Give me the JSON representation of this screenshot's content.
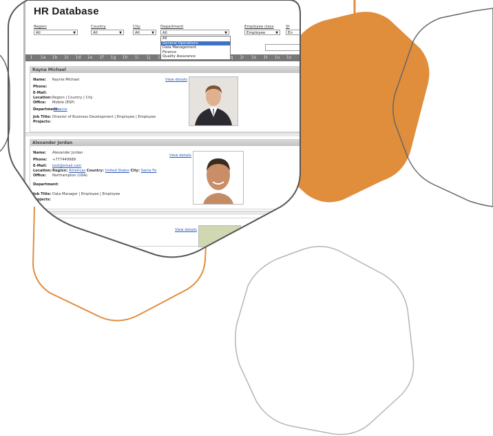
{
  "app": {
    "title": "HR Database"
  },
  "filters": [
    {
      "label": "Region",
      "value": "All"
    },
    {
      "label": "Country",
      "value": "All"
    },
    {
      "label": "City",
      "value": "All"
    },
    {
      "label": "Department",
      "value": "All"
    },
    {
      "label": "Employee class",
      "value": "Employee"
    },
    {
      "label": "St",
      "value": "En"
    }
  ],
  "department_dropdown": {
    "options": [
      "All",
      "General Operations",
      "Data Management",
      "Finance",
      "Quality Assurance"
    ],
    "highlighted": "General Operations"
  },
  "ruler": {
    "marks": [
      "1",
      "1a",
      "1b",
      "1c",
      "1d",
      "1e",
      "1f",
      "1g",
      "1h",
      "1i",
      "1j",
      "1k",
      "1l",
      "1m",
      "1n",
      "1o",
      "1p",
      "1q",
      "1r",
      "1s",
      "1t",
      "1u",
      "1v"
    ]
  },
  "employees": [
    {
      "name": "Rayna Michael",
      "name_value": "Raynie Michael",
      "phone": "",
      "email": "",
      "location": "Region | Country | City",
      "office": "Mobile (ESP)",
      "department": "Finance",
      "job_title": "Director of Business Development | Employee | Employee",
      "projects": "",
      "view_details": "View details"
    },
    {
      "name": "Alexander Jordan",
      "name_value": "Alexander Jordan",
      "phone": "+777449989",
      "email": "test@email.com",
      "location_region": "Americas",
      "location_country": "United States",
      "location_city": "Santa Fe",
      "office": "Northampton (USA)",
      "department": "",
      "job_title": "Data Manager | Employee | Employee",
      "projects": "",
      "view_details": "View details"
    }
  ],
  "field_labels": {
    "name": "Name:",
    "phone": "Phone:",
    "email": "E-Mail:",
    "location": "Location:",
    "office": "Office:",
    "department": "Department:",
    "job_title": "Job Title:",
    "projects": "Projects:",
    "region": "Region:",
    "country": "Country:",
    "city": "City:"
  },
  "third_card": {
    "view_details": "View details"
  },
  "colors": {
    "orange": "#e08d3c",
    "outline": "#555555",
    "light_outline": "#b5b5b5"
  }
}
